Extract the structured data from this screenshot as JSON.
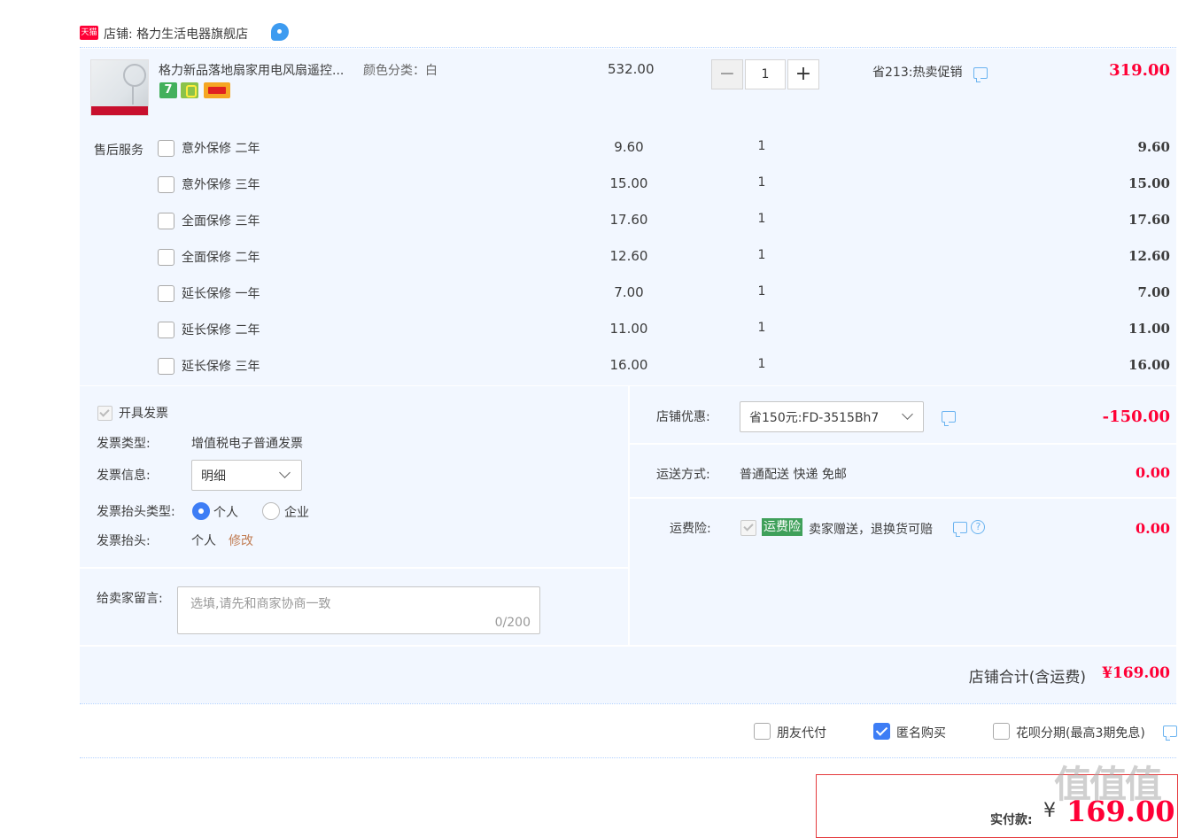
{
  "shop": {
    "tmall_badge": "天猫",
    "label": "店铺: 格力生活电器旗舰店"
  },
  "item": {
    "title": "格力新品落地扇家用电风扇遥控...",
    "sku": "颜色分类：白",
    "badge_7": "7",
    "unit_price": "532.00",
    "quantity": "1",
    "promo": "省213:热卖促销",
    "total": "319.00"
  },
  "service": {
    "label": "售后服务",
    "options": [
      {
        "name": "意外保修 二年",
        "price": "9.60",
        "qty": "1",
        "total": "9.60"
      },
      {
        "name": "意外保修 三年",
        "price": "15.00",
        "qty": "1",
        "total": "15.00"
      },
      {
        "name": "全面保修 三年",
        "price": "17.60",
        "qty": "1",
        "total": "17.60"
      },
      {
        "name": "全面保修 二年",
        "price": "12.60",
        "qty": "1",
        "total": "12.60"
      },
      {
        "name": "延长保修 一年",
        "price": "7.00",
        "qty": "1",
        "total": "7.00"
      },
      {
        "name": "延长保修 二年",
        "price": "11.00",
        "qty": "1",
        "total": "11.00"
      },
      {
        "name": "延长保修 三年",
        "price": "16.00",
        "qty": "1",
        "total": "16.00"
      }
    ]
  },
  "invoice": {
    "checkbox_label": "开具发票",
    "type_label": "发票类型:",
    "type_value": "增值税电子普通发票",
    "info_label": "发票信息:",
    "info_value": "明细",
    "title_type_label": "发票抬头类型:",
    "title_type_personal": "个人",
    "title_type_company": "企业",
    "title_label": "发票抬头:",
    "title_value": "个人",
    "edit_link": "修改"
  },
  "message": {
    "label": "给卖家留言:",
    "placeholder": "选填,请先和商家协商一致",
    "counter": "0/200"
  },
  "discount": {
    "label": "店铺优惠:",
    "coupon": "省150元:FD-3515Bh7",
    "amount": "-150.00"
  },
  "shipping": {
    "label": "运送方式:",
    "value": "普通配送 快递 免邮",
    "amount": "0.00"
  },
  "insurance": {
    "label": "运费险:",
    "badge": "运费险",
    "desc": "卖家赠送，退换货可赔",
    "help": "?",
    "amount": "0.00"
  },
  "summary": {
    "label": "店铺合计(含运费)",
    "amount": "¥169.00"
  },
  "options": {
    "friend_pay": "朋友代付",
    "anonymous": "匿名购买",
    "huabei": "花呗分期(最高3期免息)"
  },
  "payment": {
    "label": "实付款:",
    "currency": "¥",
    "amount": "169.00"
  },
  "watermark": "值值值",
  "colors": {
    "accent_red": "#ff0036",
    "panel_bg": "#f2f7ff",
    "check_blue": "#3d7df5",
    "insurance_green": "#3fa05a"
  }
}
